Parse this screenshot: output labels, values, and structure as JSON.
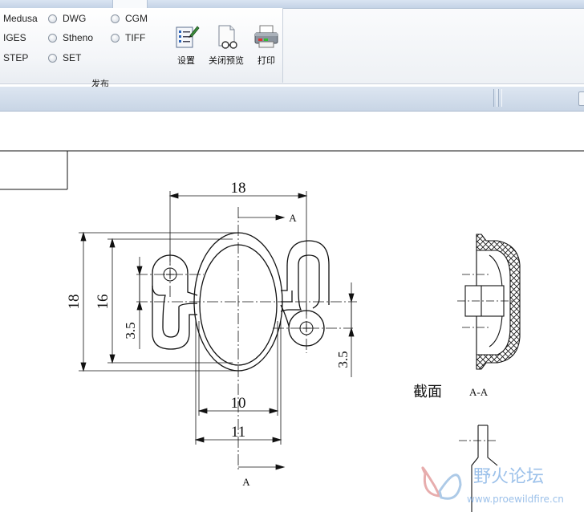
{
  "publish_group": {
    "label": "发布",
    "options": {
      "medusa": "Medusa",
      "dwg": "DWG",
      "cgm": "CGM",
      "iges": "IGES",
      "stheno": "Stheno",
      "tiff": "TIFF",
      "step": "STEP",
      "set": "SET"
    }
  },
  "tools": {
    "settings": "设置",
    "close_preview": "关闭预览",
    "print": "打印"
  },
  "drawing": {
    "dim_top_width": "18",
    "dim_outer_height": "18",
    "dim_inner_height": "16",
    "dim_left_offset": "3.5",
    "dim_right_offset": "3.5",
    "dim_width_10": "10",
    "dim_width_11": "11",
    "section_marker_top": "A",
    "section_marker_bottom": "A",
    "section_caption": "截面",
    "section_id": "A-A"
  },
  "watermark": {
    "title": "野火论坛",
    "url": "www.proewildfire.cn"
  }
}
